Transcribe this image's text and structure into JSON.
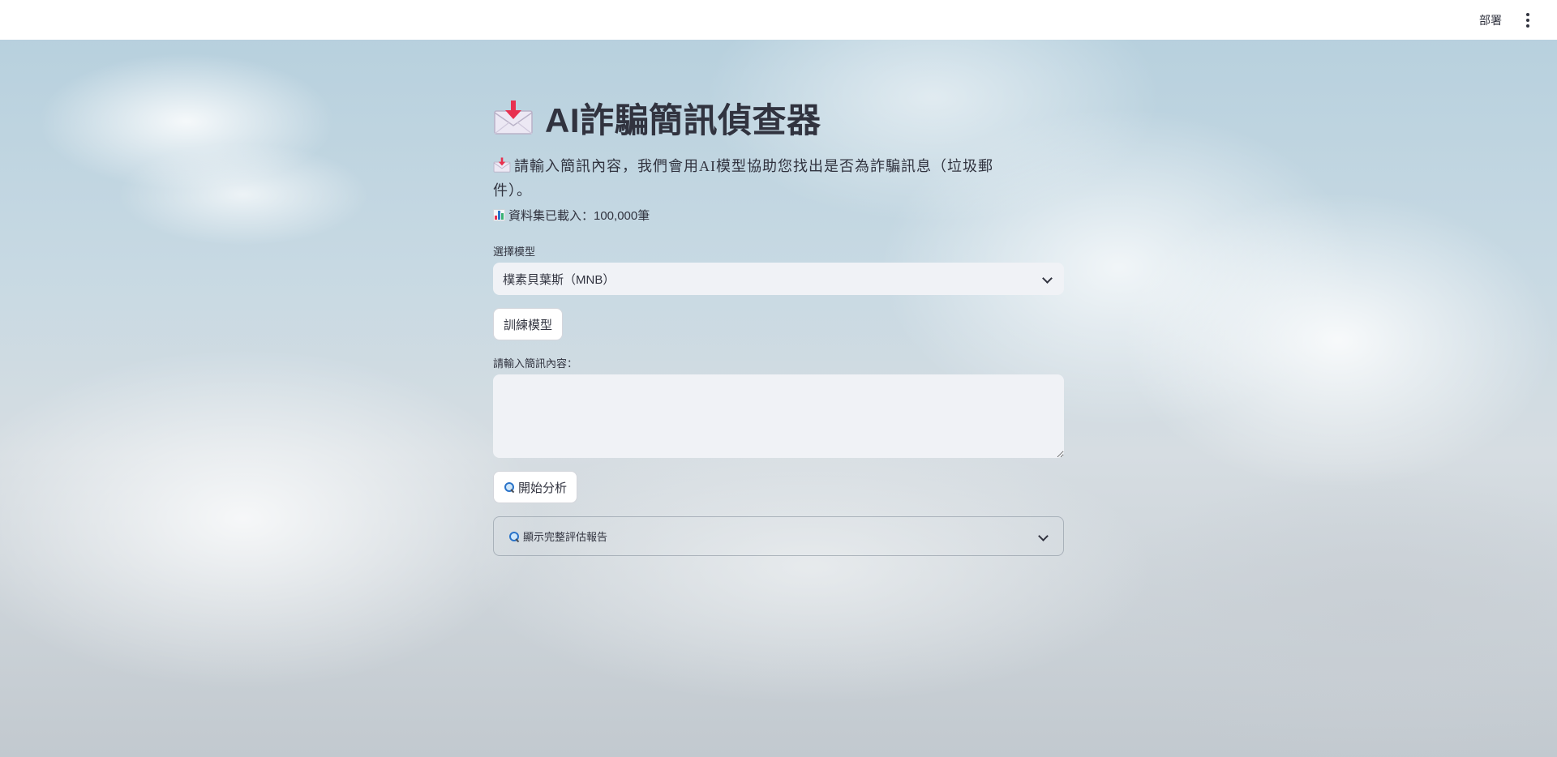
{
  "header": {
    "deploy_label": "部署"
  },
  "main": {
    "title": "AI詐騙簡訊偵查器",
    "intro": "請輸入簡訊內容，我們會用AI模型協助您找出是否為詐騙訊息（垃圾郵件）。",
    "dataset_text": "資料集已載入：100,000筆",
    "model_select": {
      "label": "選擇模型",
      "value": "樸素貝葉斯（MNB）"
    },
    "train_button": "訓練模型",
    "message_input": {
      "label": "請輸入簡訊內容：",
      "value": ""
    },
    "analyze_button": "開始分析",
    "report_expander": "顯示完整評估報告"
  },
  "icons": {
    "title_icon": "envelope-with-arrow-icon",
    "intro_icon": "envelope-with-arrow-icon",
    "dataset_icon": "bar-chart-icon",
    "analyze_icon": "magnifier-icon",
    "report_icon": "magnifier-icon",
    "select_icon": "chevron-down-icon",
    "expander_icon": "chevron-down-icon",
    "menu_icon": "vertical-dots-icon"
  },
  "colors": {
    "header_bg": "#ffffff",
    "input_bg": "#f0f2f6",
    "text": "#31333f",
    "arrow_red": "#e8304f"
  }
}
